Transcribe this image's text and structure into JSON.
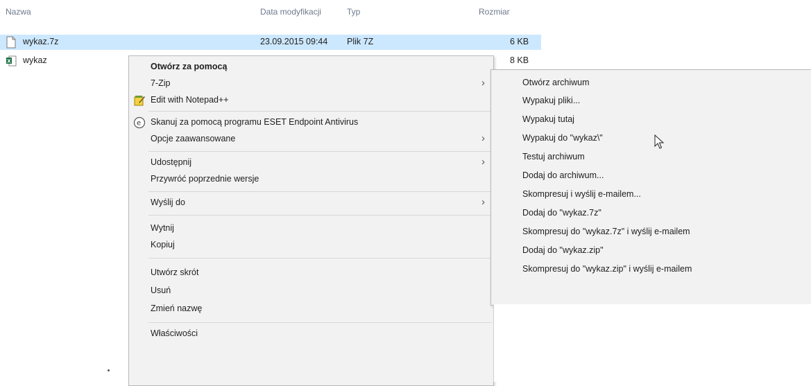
{
  "explorer": {
    "top_fragment": "",
    "columns": {
      "name": "Nazwa",
      "modified": "Data modyfikacji",
      "type": "Typ",
      "size": "Rozmiar"
    },
    "files": [
      {
        "name": "wykaz.7z",
        "modified": "23.09.2015 09:44",
        "type": "Plik 7Z",
        "size": "6 KB",
        "icon": "blank-file-icon",
        "selected": true
      },
      {
        "name": "wykaz",
        "modified": "",
        "type": "",
        "size": "8 KB",
        "icon": "excel-file-icon",
        "selected": false
      }
    ]
  },
  "context_menu": {
    "items": [
      {
        "id": "open-with",
        "label": "Otwórz za pomocą",
        "bold": true
      },
      {
        "id": "7zip",
        "label": "7-Zip",
        "submenu": true
      },
      {
        "id": "notepad",
        "label": "Edit with Notepad++",
        "icon": "notepad-icon"
      },
      {
        "id": "eset",
        "label": "Skanuj za pomocą programu ESET Endpoint Antivirus",
        "icon": "eset-icon"
      },
      {
        "id": "advanced",
        "label": "Opcje zaawansowane",
        "submenu": true
      },
      {
        "id": "share",
        "label": "Udostępnij",
        "submenu": true
      },
      {
        "id": "restore",
        "label": "Przywróć poprzednie wersje"
      },
      {
        "id": "send-to",
        "label": "Wyślij do",
        "submenu": true
      },
      {
        "id": "cut",
        "label": "Wytnij"
      },
      {
        "id": "copy",
        "label": "Kopiuj"
      },
      {
        "id": "shortcut",
        "label": "Utwórz skrót"
      },
      {
        "id": "delete",
        "label": "Usuń"
      },
      {
        "id": "rename",
        "label": "Zmień nazwę"
      },
      {
        "id": "properties",
        "label": "Właściwości"
      }
    ]
  },
  "submenu_7zip": {
    "items": [
      "Otwórz archiwum",
      "Wypakuj pliki...",
      "Wypakuj tutaj",
      "Wypakuj do \"wykaz\\\"",
      "Testuj archiwum",
      "Dodaj do archiwum...",
      "Skompresuj i wyślij e-mailem...",
      "Dodaj do \"wykaz.7z\"",
      "Skompresuj do \"wykaz.7z\" i wyślij e-mailem",
      "Dodaj do \"wykaz.zip\"",
      "Skompresuj do \"wykaz.zip\" i wyślij e-mailem"
    ],
    "hovered_index": 3
  },
  "colors": {
    "selection": "#cce8ff",
    "menu_bg": "#f2f2f2",
    "header_text": "#6d7a8c"
  }
}
